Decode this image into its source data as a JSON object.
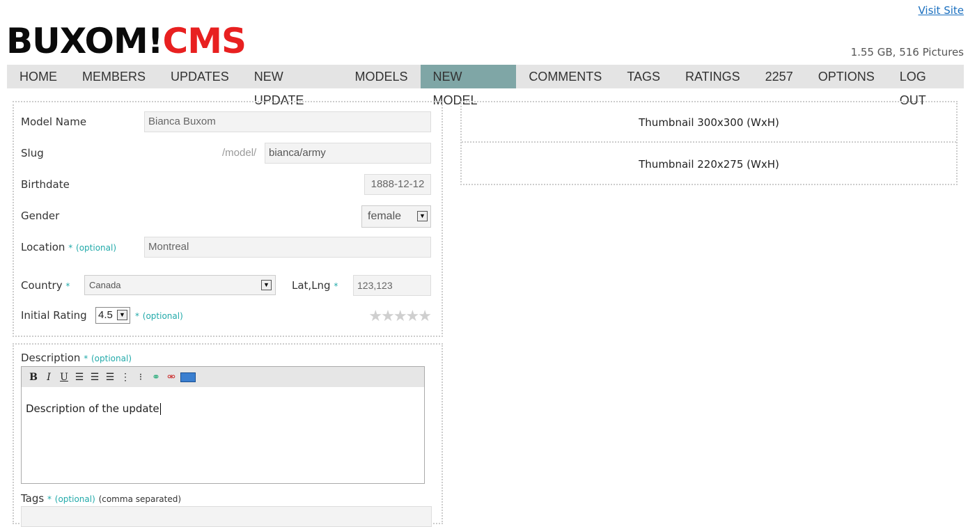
{
  "header": {
    "visit_site": "Visit Site",
    "logo_part1": "BUXOM!",
    "logo_part2": "CMS",
    "storage": "1.55 GB, 516 Pictures"
  },
  "nav": [
    {
      "label": "HOME"
    },
    {
      "label": "MEMBERS"
    },
    {
      "label": "UPDATES"
    },
    {
      "label": "NEW UPDATE"
    },
    {
      "label": "MODELS"
    },
    {
      "label": "NEW MODEL",
      "active": true
    },
    {
      "label": "COMMENTS"
    },
    {
      "label": "TAGS"
    },
    {
      "label": "RATINGS"
    },
    {
      "label": "2257"
    },
    {
      "label": "OPTIONS"
    },
    {
      "label": "LOG OUT"
    }
  ],
  "form": {
    "model_name_label": "Model Name",
    "model_name_value": "Bianca Buxom",
    "slug_label": "Slug",
    "slug_prefix": "/model/",
    "slug_value": "bianca/army",
    "birthdate_label": "Birthdate",
    "birthdate_value": "1888-12-12",
    "gender_label": "Gender",
    "gender_value": "female",
    "location_label": "Location",
    "location_value": "Montreal",
    "country_label": "Country",
    "country_value": "Canada",
    "latlng_label": "Lat,Lng",
    "latlng_value": "123,123",
    "rating_label": "Initial Rating",
    "rating_value": "4.5",
    "required_mark": "*",
    "optional_text": "(optional)",
    "stars": "★★★★★",
    "description_label": "Description",
    "description_value": "Description of the update",
    "tags_label": "Tags",
    "tags_note": "(comma separated)"
  },
  "thumbnails": {
    "thumb1": "Thumbnail 300x300 (WxH)",
    "thumb2": "Thumbnail 220x275 (WxH)"
  },
  "colors": {
    "nav_active": "#7fa6a6",
    "logo_red": "#e82020",
    "optional_teal": "#22aaaa"
  }
}
